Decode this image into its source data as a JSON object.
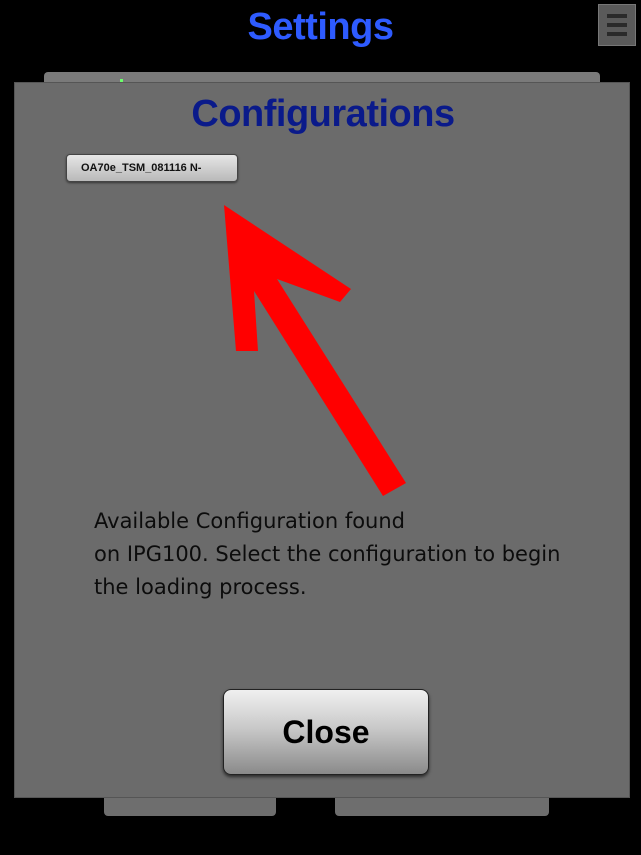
{
  "header": {
    "title": "Settings",
    "title_color": "#2e5bff",
    "menu_icon": "hamburger-icon"
  },
  "dialog": {
    "title": "Configurations",
    "title_color": "#0a1a8a",
    "background": "#6b6b6b",
    "configurations": [
      {
        "label": "OA70e_TSM_081116 N-"
      }
    ],
    "pointer_icon": "red-arrow-icon",
    "arrow_color": "#ff0000",
    "message": "Available Configuration found\n on IPG100. Select the configuration to begin\nthe loading process.",
    "close_label": "Close"
  }
}
